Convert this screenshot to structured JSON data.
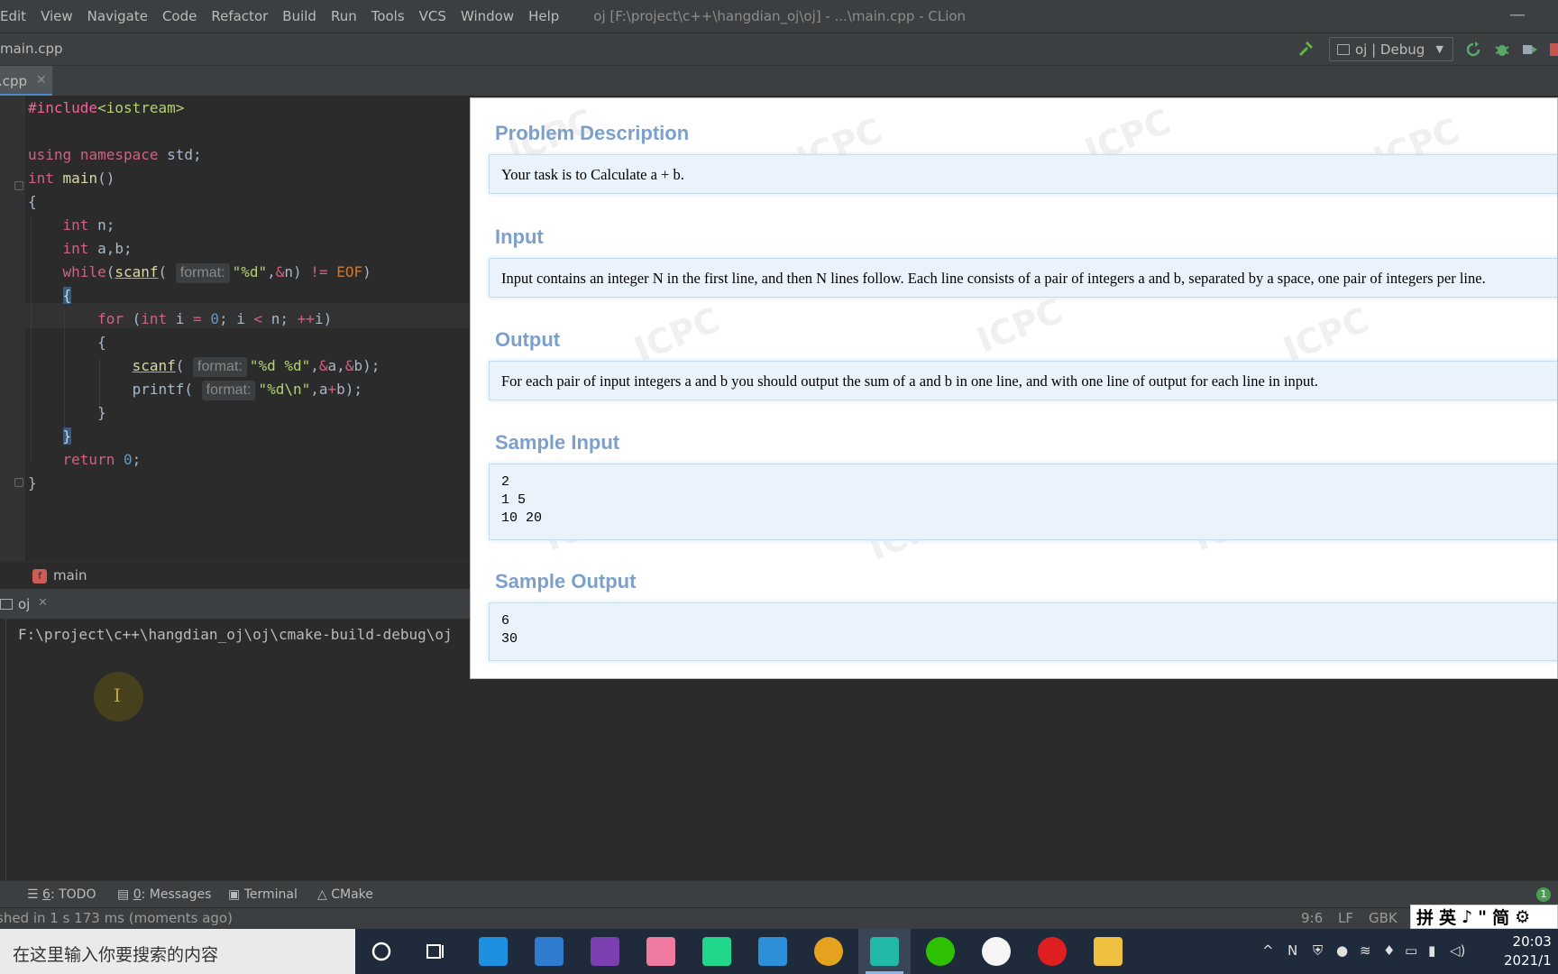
{
  "menu": {
    "items": [
      "Edit",
      "View",
      "Navigate",
      "Code",
      "Refactor",
      "Build",
      "Run",
      "Tools",
      "VCS",
      "Window",
      "Help"
    ],
    "window_title": "oj [F:\\project\\c++\\hangdian_oj\\oj] - ...\\main.cpp - CLion"
  },
  "navbar": {
    "file": "main.cpp",
    "run_config": "oj | Debug"
  },
  "editor": {
    "tab_label": ".cpp",
    "code": [
      "#include<iostream>",
      "",
      "using namespace std;",
      "int main()",
      "{",
      "    int n;",
      "    int a,b;",
      "    while(scanf( format: \"%d\",&n) != EOF)",
      "    {",
      "        for (int i = 0; i < n; ++i)",
      "        {",
      "            scanf( format: \"%d %d\",&a,&b);",
      "            printf( format: \"%d\\n\",a+b);",
      "        }",
      "    }",
      "    return 0;",
      "}"
    ],
    "hint_label": "format:",
    "breadcrumb": "main"
  },
  "run_panel": {
    "tab": "oj",
    "console_line": "F:\\project\\c++\\hangdian_oj\\oj\\cmake-build-debug\\oj"
  },
  "tool_tabs": {
    "todo": {
      "num": "6",
      "label": ": TODO"
    },
    "messages": {
      "num": "0",
      "label": ": Messages"
    },
    "terminal": "Terminal",
    "cmake": "CMake",
    "badge": "1"
  },
  "status": {
    "message": "shed in 1 s 173 ms (moments ago)",
    "position": "9:6",
    "line_sep": "LF",
    "encoding": "GBK"
  },
  "ime": {
    "label1": "拼",
    "label2": "英",
    "label3": "简"
  },
  "taskbar": {
    "search_placeholder": "在这里输入你要搜索的内容",
    "time": "20:03",
    "date": "2021/1"
  },
  "problem": {
    "sections": [
      {
        "title": "Problem Description",
        "body": "Your task is to Calculate a + b."
      },
      {
        "title": "Input",
        "body": "Input contains an integer N in the first line, and then N lines follow. Each line consists of a pair of integers a and b, separated by a space, one pair of integers per line."
      },
      {
        "title": "Output",
        "body": "For each pair of input integers a and b you should output the sum of a and b in one line, and with one line of output for each line in input."
      },
      {
        "title": "Sample Input",
        "body": "2\n1 5\n10 20"
      },
      {
        "title": "Sample Output",
        "body": "6\n30"
      }
    ],
    "watermark": "ICPC"
  },
  "colors": {
    "accent": "#4a88c7",
    "section_title": "#7ca0cc",
    "box_bg": "#eaf3fb"
  }
}
